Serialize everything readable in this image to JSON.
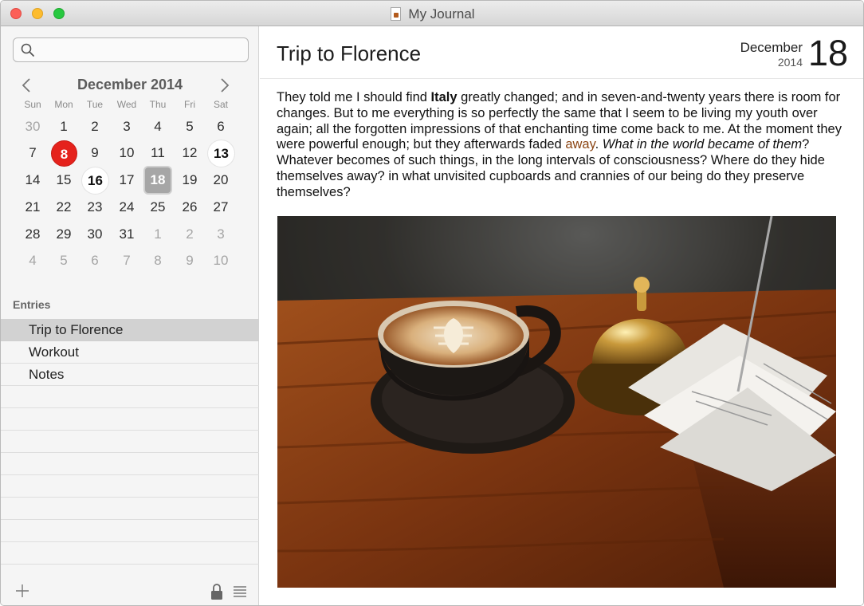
{
  "window": {
    "title": "My Journal"
  },
  "search": {
    "placeholder": "",
    "value": ""
  },
  "calendar": {
    "month_label": "December 2014",
    "weekdays": [
      "Sun",
      "Mon",
      "Tue",
      "Wed",
      "Thu",
      "Fri",
      "Sat"
    ],
    "weeks": [
      [
        "30",
        "1",
        "2",
        "3",
        "4",
        "5",
        "6"
      ],
      [
        "7",
        "8",
        "9",
        "10",
        "11",
        "12",
        "13"
      ],
      [
        "14",
        "15",
        "16",
        "17",
        "18",
        "19",
        "20"
      ],
      [
        "21",
        "22",
        "23",
        "24",
        "25",
        "26",
        "27"
      ],
      [
        "28",
        "29",
        "30",
        "31",
        "1",
        "2",
        "3"
      ],
      [
        "4",
        "5",
        "6",
        "7",
        "8",
        "9",
        "10"
      ]
    ],
    "today": "8",
    "selected": "18",
    "days_with_entries": [
      "13",
      "16"
    ]
  },
  "sidebar": {
    "entries_label": "Entries",
    "entries": [
      {
        "label": "Trip to Florence",
        "selected": true
      },
      {
        "label": "Workout",
        "selected": false
      },
      {
        "label": "Notes",
        "selected": false
      }
    ],
    "add_icon": "plus-icon",
    "lock_icon": "lock-icon",
    "list_icon": "list-icon"
  },
  "entry": {
    "title": "Trip to Florence",
    "date_month": "December",
    "date_year": "2014",
    "date_day": "18",
    "body": {
      "s1": "They told me I should find ",
      "bold": "Italy",
      "s2": " greatly changed; and in seven-and-twenty years there is room for changes. But to me everything is so perfectly the same that I seem to be living my youth over again; all the forgotten impressions of that enchanting time come back to me.  At the moment they were powerful enough; but they afterwards faded ",
      "colored": "away",
      "s3": ".  ",
      "italic": "What in the world became of them",
      "s4": "?  Whatever becomes of such things, in the long intervals of consciousness? Where do they hide themselves away? in what unvisited cupboards and crannies of our being do they preserve themselves?"
    },
    "image": "coffee-cup-photo"
  },
  "colors": {
    "today": "#e5221c",
    "selected_day": "#a6a6a6",
    "accent_word": "#8b4513",
    "sidebar_bg": "#f5f5f5",
    "selected_row": "#d2d2d2"
  }
}
